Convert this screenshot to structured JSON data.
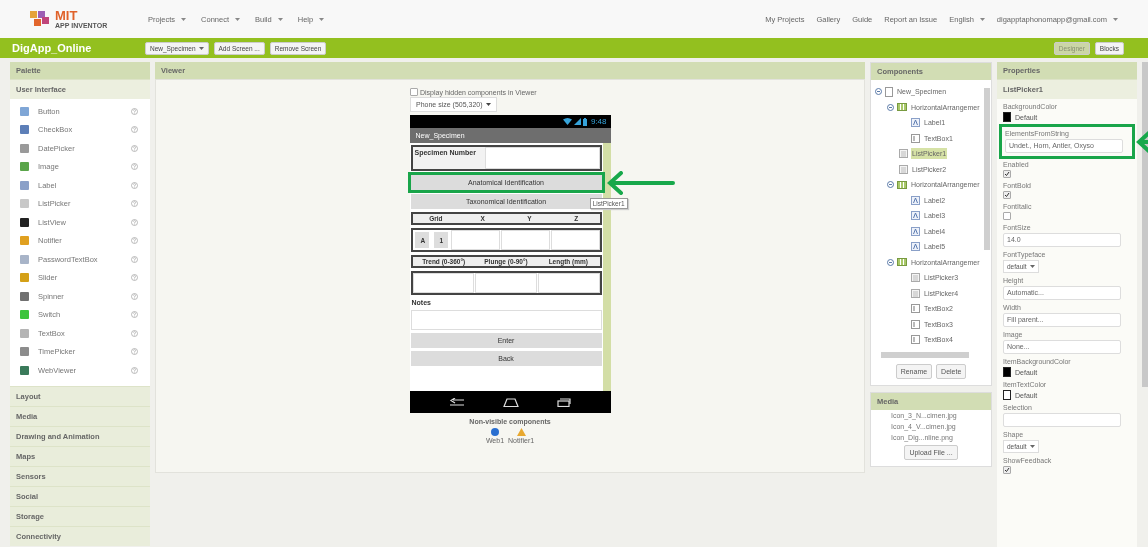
{
  "header": {
    "logo": {
      "title": "MIT",
      "subtitle": "APP INVENTOR"
    },
    "menu": [
      {
        "label": "Projects",
        "dropdown": true
      },
      {
        "label": "Connect",
        "dropdown": true
      },
      {
        "label": "Build",
        "dropdown": true
      },
      {
        "label": "Help",
        "dropdown": true
      }
    ],
    "links": [
      {
        "label": "My Projects",
        "dropdown": false
      },
      {
        "label": "Gallery",
        "dropdown": false
      },
      {
        "label": "Guide",
        "dropdown": false
      },
      {
        "label": "Report an Issue",
        "dropdown": false
      },
      {
        "label": "English",
        "dropdown": true
      },
      {
        "label": "digapptaphonomapp@gmail.com",
        "dropdown": true
      }
    ]
  },
  "project_bar": {
    "title": "DigApp_Online",
    "buttons": [
      {
        "label": "New_Specimen",
        "dropdown": true
      },
      {
        "label": "Add Screen ...",
        "dropdown": false
      },
      {
        "label": "Remove Screen",
        "dropdown": false
      }
    ],
    "modes": [
      {
        "label": "Designer",
        "selected": true
      },
      {
        "label": "Blocks",
        "selected": false
      }
    ]
  },
  "palette": {
    "title": "Palette",
    "open_category": "User Interface",
    "items": [
      {
        "label": "Button",
        "color": "#7fa6d6"
      },
      {
        "label": "CheckBox",
        "color": "#5d7fb8"
      },
      {
        "label": "DatePicker",
        "color": "#9a9a9a"
      },
      {
        "label": "Image",
        "color": "#5aa54a"
      },
      {
        "label": "Label",
        "color": "#8aa0c8"
      },
      {
        "label": "ListPicker",
        "color": "#c8c8c8"
      },
      {
        "label": "ListView",
        "color": "#222222"
      },
      {
        "label": "Notifier",
        "color": "#e0a020"
      },
      {
        "label": "PasswordTextBox",
        "color": "#a8b4c8"
      },
      {
        "label": "Slider",
        "color": "#d4a017"
      },
      {
        "label": "Spinner",
        "color": "#707070"
      },
      {
        "label": "Switch",
        "color": "#3cc43c"
      },
      {
        "label": "TextBox",
        "color": "#b4b4b4"
      },
      {
        "label": "TimePicker",
        "color": "#8c8c8c"
      },
      {
        "label": "WebViewer",
        "color": "#3a7a5a"
      }
    ],
    "categories": [
      "Layout",
      "Media",
      "Drawing and Animation",
      "Maps",
      "Sensors",
      "Social",
      "Storage",
      "Connectivity"
    ]
  },
  "viewer": {
    "title": "Viewer",
    "hidden_checkbox": {
      "label": "Display hidden components in Viewer",
      "checked": false
    },
    "size_select": "Phone size (505,320)",
    "phone": {
      "time": "9:48",
      "screen_title": "New_Specimen",
      "rows": [
        {
          "kind": "label_field",
          "label": "Specimen Number"
        },
        {
          "kind": "button",
          "label": "Anatomical Identification",
          "highlighted": true
        },
        {
          "kind": "button",
          "label": "Taxonomical Identification",
          "highlighted": false,
          "tooltip": "ListPicker1"
        },
        {
          "kind": "header",
          "cells": [
            "Grid",
            "X",
            "Y",
            "Z"
          ]
        },
        {
          "kind": "input_row",
          "buttons": [
            "A",
            "1"
          ],
          "fields": [
            {
              "kind": "textbox"
            },
            {
              "kind": "textbox"
            },
            {
              "kind": "textbox"
            }
          ]
        },
        {
          "kind": "header",
          "cells": [
            "Trend (0-360°)",
            "Plunge (0-90°)",
            "Length (mm)"
          ]
        },
        {
          "kind": "input_row",
          "buttons": [],
          "fields": [
            {
              "kind": "textbox"
            },
            {
              "kind": "textbox"
            },
            {
              "kind": "textbox"
            }
          ]
        },
        {
          "kind": "label",
          "label": "Notes"
        },
        {
          "kind": "textbox"
        },
        {
          "kind": "button",
          "label": "Enter",
          "highlighted": false
        },
        {
          "kind": "button",
          "label": "Back",
          "highlighted": false
        }
      ]
    },
    "nonvisible": {
      "title": "Non-visible components",
      "items": [
        {
          "label": "Web1",
          "kind": "web"
        },
        {
          "label": "Notifier1",
          "kind": "notifier"
        }
      ]
    }
  },
  "components": {
    "title": "Components",
    "tree": [
      {
        "label": "New_Specimen",
        "kind": "screen",
        "selected": false,
        "expanded": true,
        "children": [
          {
            "label": "HorizontalArrangemer",
            "kind": "arrangement",
            "selected": false,
            "expanded": true,
            "children": [
              {
                "label": "Label1",
                "kind": "label",
                "selected": false
              },
              {
                "label": "TextBox1",
                "kind": "textbox",
                "selected": false
              }
            ]
          },
          {
            "label": "ListPicker1",
            "kind": "listpicker",
            "selected": true
          },
          {
            "label": "ListPicker2",
            "kind": "listpicker",
            "selected": false
          },
          {
            "label": "HorizontalArrangemer",
            "kind": "arrangement",
            "selected": false,
            "expanded": true,
            "children": [
              {
                "label": "Label2",
                "kind": "label",
                "selected": false
              },
              {
                "label": "Label3",
                "kind": "label",
                "selected": false
              },
              {
                "label": "Label4",
                "kind": "label",
                "selected": false
              },
              {
                "label": "Label5",
                "kind": "label",
                "selected": false
              }
            ]
          },
          {
            "label": "HorizontalArrangemer",
            "kind": "arrangement",
            "selected": false,
            "expanded": true,
            "children": [
              {
                "label": "ListPicker3",
                "kind": "listpicker",
                "selected": false
              },
              {
                "label": "ListPicker4",
                "kind": "listpicker",
                "selected": false
              },
              {
                "label": "TextBox2",
                "kind": "textbox",
                "selected": false
              },
              {
                "label": "TextBox3",
                "kind": "textbox",
                "selected": false
              },
              {
                "label": "TextBox4",
                "kind": "textbox",
                "selected": false
              }
            ]
          }
        ]
      }
    ],
    "buttons": [
      "Rename",
      "Delete"
    ]
  },
  "media": {
    "title": "Media",
    "files": [
      "Icon_3_N...cimen.jpg",
      "Icon_4_V...cimen.jpg",
      "Icon_Dig...nline.png"
    ],
    "upload_button": "Upload File ..."
  },
  "properties": {
    "title": "Properties",
    "component": "ListPicker1",
    "items": [
      {
        "name": "BackgroundColor",
        "kind": "color",
        "color": "#000000",
        "value": "Default"
      },
      {
        "name": "ElementsFromString",
        "kind": "text",
        "value": "Undet., Horn, Antler, Oxyso",
        "highlighted": true
      },
      {
        "name": "Enabled",
        "kind": "checkbox",
        "checked": true
      },
      {
        "name": "FontBold",
        "kind": "checkbox",
        "checked": true
      },
      {
        "name": "FontItalic",
        "kind": "checkbox",
        "checked": false
      },
      {
        "name": "FontSize",
        "kind": "text",
        "value": "14.0"
      },
      {
        "name": "FontTypeface",
        "kind": "select",
        "value": "default"
      },
      {
        "name": "Height",
        "kind": "text",
        "value": "Automatic..."
      },
      {
        "name": "Width",
        "kind": "text",
        "value": "Fill parent..."
      },
      {
        "name": "Image",
        "kind": "text",
        "value": "None..."
      },
      {
        "name": "ItemBackgroundColor",
        "kind": "color",
        "color": "#000000",
        "value": "Default"
      },
      {
        "name": "ItemTextColor",
        "kind": "color",
        "color": "#ffffff",
        "value": "Default"
      },
      {
        "name": "Selection",
        "kind": "text"
      },
      {
        "name": "Shape",
        "kind": "select",
        "value": "default"
      },
      {
        "name": "ShowFeedback",
        "kind": "checkbox",
        "checked": true
      }
    ]
  }
}
